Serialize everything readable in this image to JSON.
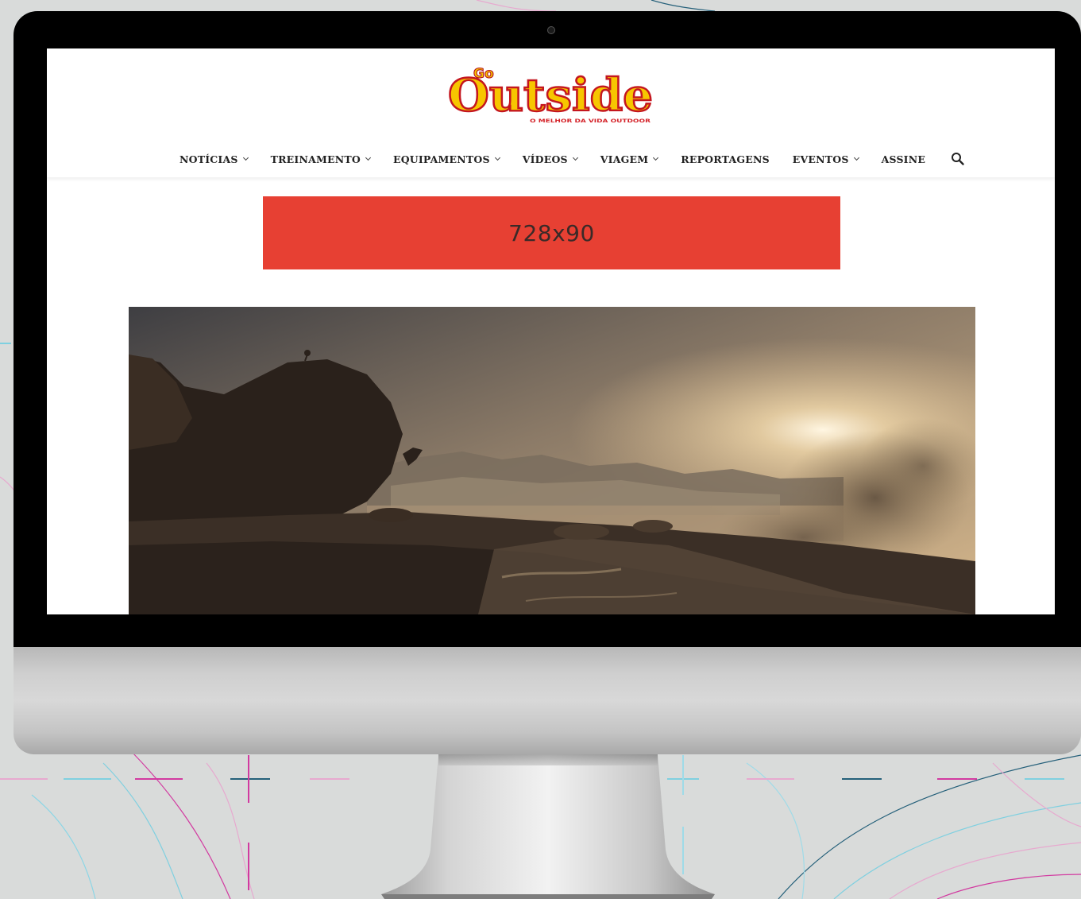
{
  "site": {
    "logo_top": "Go",
    "logo_main": "Outside",
    "logo_tagline": "O MELHOR DA VIDA OUTDOOR"
  },
  "nav": {
    "items": [
      {
        "label": "NOTÍCIAS",
        "dropdown": true
      },
      {
        "label": "TREINAMENTO",
        "dropdown": true
      },
      {
        "label": "EQUIPAMENTOS",
        "dropdown": true
      },
      {
        "label": "VÍDEOS",
        "dropdown": true
      },
      {
        "label": "VIAGEM",
        "dropdown": true
      },
      {
        "label": "REPORTAGENS",
        "dropdown": false
      },
      {
        "label": "EVENTOS",
        "dropdown": true
      },
      {
        "label": "ASSINE",
        "dropdown": false
      }
    ],
    "search_icon": "search-icon"
  },
  "ad": {
    "label": "728x90",
    "color": "#e74033"
  },
  "hero": {
    "icon": "hero-image"
  },
  "colors": {
    "logo_yellow": "#f7c600",
    "logo_red": "#e5202b",
    "background": "#d9dbda"
  }
}
